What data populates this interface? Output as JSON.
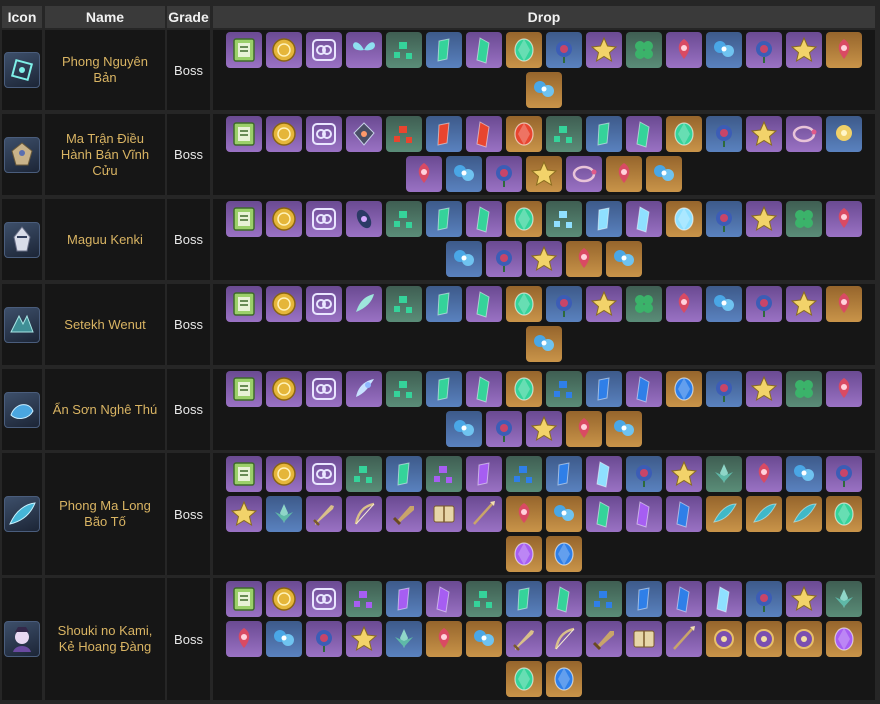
{
  "headers": {
    "icon": "Icon",
    "name": "Name",
    "grade": "Grade",
    "drop": "Drop"
  },
  "colors": {
    "name_text": "#d9b463",
    "header_bg": "#3a3a3a",
    "cell_bg": "#161616",
    "rarity": {
      "1": "#5b5b62",
      "2": "#4c7867",
      "3": "#4a6ea5",
      "4": "#8360ad",
      "5": "#b07f3a"
    }
  },
  "rows": [
    {
      "name": "Phong Nguyên Bản",
      "grade": "Boss",
      "avatar": "cube-boss-icon",
      "drops": [
        {
          "icon": "character-exp-book-icon",
          "rarity": 4
        },
        {
          "icon": "mora-coin-icon",
          "rarity": 4
        },
        {
          "icon": "companionship-exp-icon",
          "rarity": 4
        },
        {
          "icon": "butterfly-core-icon",
          "rarity": 4
        },
        {
          "icon": "anemo-sliver-icon",
          "rarity": 2
        },
        {
          "icon": "anemo-fragment-icon",
          "rarity": 3
        },
        {
          "icon": "anemo-chunk-icon",
          "rarity": 4
        },
        {
          "icon": "anemo-gemstone-icon",
          "rarity": 5
        },
        {
          "icon": "rose-artifact-icon",
          "rarity": 3
        },
        {
          "icon": "star-artifact-icon",
          "rarity": 4
        },
        {
          "icon": "clover-artifact-icon",
          "rarity": 2
        },
        {
          "icon": "red-flower-artifact-icon",
          "rarity": 4
        },
        {
          "icon": "blue-flower-artifact-icon",
          "rarity": 3
        },
        {
          "icon": "rose-artifact-icon",
          "rarity": 4
        },
        {
          "icon": "star-artifact-icon",
          "rarity": 4
        },
        {
          "icon": "red-flower-artifact-icon",
          "rarity": 5
        },
        {
          "icon": "blue-flower-artifact-icon",
          "rarity": 5
        }
      ]
    },
    {
      "name": "Ma Trận Điều Hành Bán Vĩnh Cửu",
      "grade": "Boss",
      "avatar": "construct-boss-icon",
      "drops": [
        {
          "icon": "character-exp-book-icon",
          "rarity": 4
        },
        {
          "icon": "mora-coin-icon",
          "rarity": 4
        },
        {
          "icon": "companionship-exp-icon",
          "rarity": 4
        },
        {
          "icon": "pyramid-core-icon",
          "rarity": 4
        },
        {
          "icon": "pyro-sliver-icon",
          "rarity": 2
        },
        {
          "icon": "pyro-fragment-icon",
          "rarity": 3
        },
        {
          "icon": "pyro-chunk-icon",
          "rarity": 4
        },
        {
          "icon": "pyro-gemstone-icon",
          "rarity": 5
        },
        {
          "icon": "anemo-sliver-icon",
          "rarity": 2
        },
        {
          "icon": "anemo-fragment-icon",
          "rarity": 3
        },
        {
          "icon": "anemo-chunk-icon",
          "rarity": 4
        },
        {
          "icon": "anemo-gemstone-icon",
          "rarity": 5
        },
        {
          "icon": "rose-artifact-icon",
          "rarity": 3
        },
        {
          "icon": "star-artifact-icon",
          "rarity": 4
        },
        {
          "icon": "ring-artifact-icon",
          "rarity": 4
        },
        {
          "icon": "yellow-flower-artifact-icon",
          "rarity": 3
        },
        {
          "icon": "red-flower-artifact-icon",
          "rarity": 4
        },
        {
          "icon": "blue-flower-artifact-icon",
          "rarity": 3
        },
        {
          "icon": "rose-artifact-icon",
          "rarity": 4
        },
        {
          "icon": "star-artifact-icon",
          "rarity": 5
        },
        {
          "icon": "ring-artifact-icon",
          "rarity": 4
        },
        {
          "icon": "red-flower-artifact-icon",
          "rarity": 5
        },
        {
          "icon": "blue-flower-artifact-icon",
          "rarity": 5
        }
      ]
    },
    {
      "name": "Maguu Kenki",
      "grade": "Boss",
      "avatar": "samurai-boss-icon",
      "drops": [
        {
          "icon": "character-exp-book-icon",
          "rarity": 4
        },
        {
          "icon": "mora-coin-icon",
          "rarity": 4
        },
        {
          "icon": "companionship-exp-icon",
          "rarity": 4
        },
        {
          "icon": "mask-core-icon",
          "rarity": 4
        },
        {
          "icon": "anemo-sliver-icon",
          "rarity": 2
        },
        {
          "icon": "anemo-fragment-icon",
          "rarity": 3
        },
        {
          "icon": "anemo-chunk-icon",
          "rarity": 4
        },
        {
          "icon": "anemo-gemstone-icon",
          "rarity": 5
        },
        {
          "icon": "cryo-sliver-icon",
          "rarity": 2
        },
        {
          "icon": "cryo-fragment-icon",
          "rarity": 3
        },
        {
          "icon": "cryo-chunk-icon",
          "rarity": 4
        },
        {
          "icon": "cryo-gemstone-icon",
          "rarity": 5
        },
        {
          "icon": "rose-artifact-icon",
          "rarity": 3
        },
        {
          "icon": "star-artifact-icon",
          "rarity": 4
        },
        {
          "icon": "clover-artifact-icon",
          "rarity": 2
        },
        {
          "icon": "red-flower-artifact-icon",
          "rarity": 4
        },
        {
          "icon": "blue-flower-artifact-icon",
          "rarity": 3
        },
        {
          "icon": "rose-artifact-icon",
          "rarity": 4
        },
        {
          "icon": "star-artifact-icon",
          "rarity": 4
        },
        {
          "icon": "red-flower-artifact-icon",
          "rarity": 5
        },
        {
          "icon": "blue-flower-artifact-icon",
          "rarity": 5
        }
      ]
    },
    {
      "name": "Setekh Wenut",
      "grade": "Boss",
      "avatar": "wyrm-boss-icon",
      "drops": [
        {
          "icon": "character-exp-book-icon",
          "rarity": 4
        },
        {
          "icon": "mora-coin-icon",
          "rarity": 4
        },
        {
          "icon": "companionship-exp-icon",
          "rarity": 4
        },
        {
          "icon": "feather-core-icon",
          "rarity": 4
        },
        {
          "icon": "anemo-sliver-icon",
          "rarity": 2
        },
        {
          "icon": "anemo-fragment-icon",
          "rarity": 3
        },
        {
          "icon": "anemo-chunk-icon",
          "rarity": 4
        },
        {
          "icon": "anemo-gemstone-icon",
          "rarity": 5
        },
        {
          "icon": "rose-artifact-icon",
          "rarity": 3
        },
        {
          "icon": "star-artifact-icon",
          "rarity": 4
        },
        {
          "icon": "clover-artifact-icon",
          "rarity": 2
        },
        {
          "icon": "red-flower-artifact-icon",
          "rarity": 4
        },
        {
          "icon": "blue-flower-artifact-icon",
          "rarity": 3
        },
        {
          "icon": "rose-artifact-icon",
          "rarity": 4
        },
        {
          "icon": "star-artifact-icon",
          "rarity": 4
        },
        {
          "icon": "red-flower-artifact-icon",
          "rarity": 5
        },
        {
          "icon": "blue-flower-artifact-icon",
          "rarity": 5
        }
      ]
    },
    {
      "name": "Ẩn Sơn Nghê Thú",
      "grade": "Boss",
      "avatar": "beast-boss-icon",
      "drops": [
        {
          "icon": "character-exp-book-icon",
          "rarity": 4
        },
        {
          "icon": "mora-coin-icon",
          "rarity": 4
        },
        {
          "icon": "companionship-exp-icon",
          "rarity": 4
        },
        {
          "icon": "horn-core-icon",
          "rarity": 4
        },
        {
          "icon": "anemo-sliver-icon",
          "rarity": 2
        },
        {
          "icon": "anemo-fragment-icon",
          "rarity": 3
        },
        {
          "icon": "anemo-chunk-icon",
          "rarity": 4
        },
        {
          "icon": "anemo-gemstone-icon",
          "rarity": 5
        },
        {
          "icon": "hydro-sliver-icon",
          "rarity": 2
        },
        {
          "icon": "hydro-fragment-icon",
          "rarity": 3
        },
        {
          "icon": "hydro-chunk-icon",
          "rarity": 4
        },
        {
          "icon": "hydro-gemstone-icon",
          "rarity": 5
        },
        {
          "icon": "rose-artifact-icon",
          "rarity": 3
        },
        {
          "icon": "star-artifact-icon",
          "rarity": 4
        },
        {
          "icon": "clover-artifact-icon",
          "rarity": 2
        },
        {
          "icon": "red-flower-artifact-icon",
          "rarity": 4
        },
        {
          "icon": "blue-flower-artifact-icon",
          "rarity": 3
        },
        {
          "icon": "rose-artifact-icon",
          "rarity": 4
        },
        {
          "icon": "star-artifact-icon",
          "rarity": 4
        },
        {
          "icon": "red-flower-artifact-icon",
          "rarity": 5
        },
        {
          "icon": "blue-flower-artifact-icon",
          "rarity": 5
        }
      ]
    },
    {
      "name": "Phong Ma Long Bão Tố",
      "grade": "Boss",
      "avatar": "dragon-boss-icon",
      "drops": [
        {
          "icon": "character-exp-book-icon",
          "rarity": 4
        },
        {
          "icon": "mora-coin-icon",
          "rarity": 4
        },
        {
          "icon": "companionship-exp-icon",
          "rarity": 4
        },
        {
          "icon": "anemo-sliver-icon",
          "rarity": 2
        },
        {
          "icon": "anemo-fragment-icon",
          "rarity": 3
        },
        {
          "icon": "electro-sliver-icon",
          "rarity": 2
        },
        {
          "icon": "electro-fragment-icon",
          "rarity": 4
        },
        {
          "icon": "hydro-sliver-icon",
          "rarity": 2
        },
        {
          "icon": "hydro-fragment-icon",
          "rarity": 3
        },
        {
          "icon": "cryo-chunk-icon",
          "rarity": 4
        },
        {
          "icon": "rose-artifact-icon",
          "rarity": 3
        },
        {
          "icon": "star-artifact-icon",
          "rarity": 4
        },
        {
          "icon": "lotus-artifact-icon",
          "rarity": 2
        },
        {
          "icon": "red-flower-artifact-icon",
          "rarity": 4
        },
        {
          "icon": "blue-flower-artifact-icon",
          "rarity": 3
        },
        {
          "icon": "rose-artifact-icon",
          "rarity": 4
        },
        {
          "icon": "star-artifact-icon",
          "rarity": 4
        },
        {
          "icon": "lotus-artifact-icon",
          "rarity": 3
        },
        {
          "icon": "sword-weapon-icon",
          "rarity": 4
        },
        {
          "icon": "bow-weapon-icon",
          "rarity": 4
        },
        {
          "icon": "claymore-weapon-icon",
          "rarity": 4
        },
        {
          "icon": "catalyst-weapon-icon",
          "rarity": 4
        },
        {
          "icon": "polearm-weapon-icon",
          "rarity": 4
        },
        {
          "icon": "red-flower-artifact-icon",
          "rarity": 5
        },
        {
          "icon": "blue-flower-artifact-icon",
          "rarity": 5
        },
        {
          "icon": "anemo-chunk-icon",
          "rarity": 4
        },
        {
          "icon": "electro-chunk-icon",
          "rarity": 4
        },
        {
          "icon": "hydro-chunk-icon",
          "rarity": 4
        },
        {
          "icon": "dragon-wing-core-icon",
          "rarity": 5
        },
        {
          "icon": "dragon-claw-core-icon",
          "rarity": 5
        },
        {
          "icon": "dragon-tear-core-icon",
          "rarity": 5
        },
        {
          "icon": "anemo-gemstone-icon",
          "rarity": 5
        },
        {
          "icon": "electro-gemstone-icon",
          "rarity": 5
        },
        {
          "icon": "hydro-gemstone-icon",
          "rarity": 5
        }
      ]
    },
    {
      "name": "Shouki no Kami, Kẻ Hoang Đàng",
      "grade": "Boss",
      "avatar": "puppet-boss-icon",
      "drops": [
        {
          "icon": "character-exp-book-icon",
          "rarity": 4
        },
        {
          "icon": "mora-coin-icon",
          "rarity": 4
        },
        {
          "icon": "companionship-exp-icon",
          "rarity": 4
        },
        {
          "icon": "electro-sliver-icon",
          "rarity": 2
        },
        {
          "icon": "electro-fragment-icon",
          "rarity": 3
        },
        {
          "icon": "electro-chunk-icon",
          "rarity": 4
        },
        {
          "icon": "anemo-sliver-icon",
          "rarity": 2
        },
        {
          "icon": "anemo-fragment-icon",
          "rarity": 3
        },
        {
          "icon": "anemo-chunk-icon",
          "rarity": 4
        },
        {
          "icon": "hydro-sliver-icon",
          "rarity": 2
        },
        {
          "icon": "hydro-fragment-icon",
          "rarity": 3
        },
        {
          "icon": "hydro-chunk-icon",
          "rarity": 4
        },
        {
          "icon": "cryo-chunk-icon",
          "rarity": 4
        },
        {
          "icon": "rose-artifact-icon",
          "rarity": 3
        },
        {
          "icon": "star-artifact-icon",
          "rarity": 4
        },
        {
          "icon": "lotus-artifact-icon",
          "rarity": 2
        },
        {
          "icon": "red-flower-artifact-icon",
          "rarity": 4
        },
        {
          "icon": "blue-flower-artifact-icon",
          "rarity": 3
        },
        {
          "icon": "rose-artifact-icon",
          "rarity": 4
        },
        {
          "icon": "star-artifact-icon",
          "rarity": 4
        },
        {
          "icon": "lotus-artifact-icon",
          "rarity": 3
        },
        {
          "icon": "red-flower-artifact-icon",
          "rarity": 5
        },
        {
          "icon": "blue-flower-artifact-icon",
          "rarity": 5
        },
        {
          "icon": "sword-weapon-icon",
          "rarity": 4
        },
        {
          "icon": "bow-weapon-icon",
          "rarity": 4
        },
        {
          "icon": "claymore-weapon-icon",
          "rarity": 4
        },
        {
          "icon": "catalyst-weapon-icon",
          "rarity": 4
        },
        {
          "icon": "polearm-weapon-icon",
          "rarity": 4
        },
        {
          "icon": "puppet-crown-core-icon",
          "rarity": 5
        },
        {
          "icon": "puppet-eye-core-icon",
          "rarity": 5
        },
        {
          "icon": "puppet-hat-core-icon",
          "rarity": 5
        },
        {
          "icon": "electro-gemstone-icon",
          "rarity": 5
        },
        {
          "icon": "anemo-gemstone-icon",
          "rarity": 5
        },
        {
          "icon": "hydro-gemstone-icon",
          "rarity": 5
        }
      ]
    }
  ]
}
